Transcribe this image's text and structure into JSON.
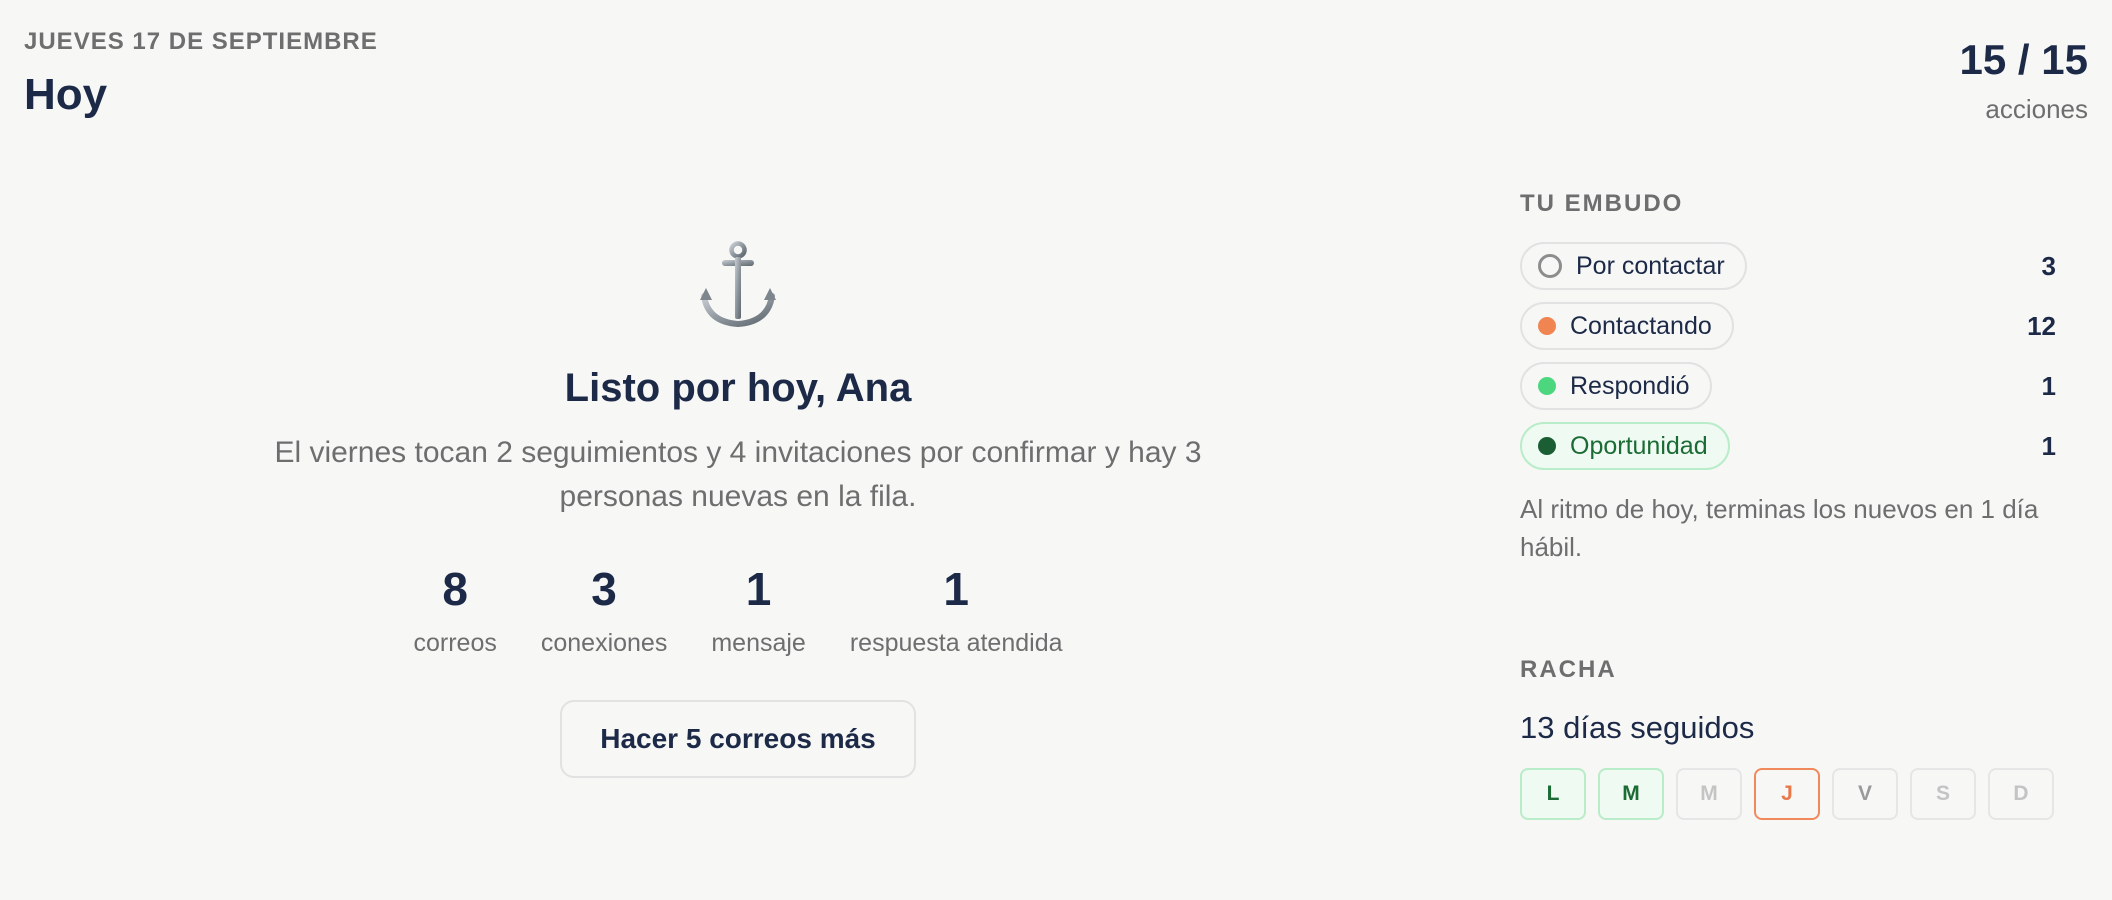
{
  "header": {
    "date": "JUEVES 17 DE SEPTIEMBRE",
    "title": "Hoy",
    "actions_count": "15 / 15",
    "actions_label": "acciones"
  },
  "main": {
    "icon": "anchor-icon",
    "title": "Listo por hoy, Ana",
    "text": "El viernes tocan 2 seguimientos y 4 invitaciones por confirmar y hay 3 personas nuevas en la fila.",
    "stats": [
      {
        "value": "8",
        "label": "correos"
      },
      {
        "value": "3",
        "label": "conexiones"
      },
      {
        "value": "1",
        "label": "mensaje"
      },
      {
        "value": "1",
        "label": "respuesta atendida"
      }
    ],
    "button_label": "Hacer 5 correos más"
  },
  "funnel": {
    "label": "TU EMBUDO",
    "items": [
      {
        "label": "Por contactar",
        "count": "3",
        "color": "#8d8d8d",
        "style": "ring"
      },
      {
        "label": "Contactando",
        "count": "12",
        "color": "#f08552",
        "style": "dot"
      },
      {
        "label": "Respondió",
        "count": "1",
        "color": "#4cd77f",
        "style": "dot"
      },
      {
        "label": "Oportunidad",
        "count": "1",
        "color": "#1b5e34",
        "style": "dot"
      }
    ],
    "pace_text": "Al ritmo de hoy, terminas los nuevos en 1 día hábil."
  },
  "streak": {
    "label": "RACHA",
    "text": "13 días seguidos",
    "days": [
      {
        "label": "L",
        "state": "done"
      },
      {
        "label": "M",
        "state": "done"
      },
      {
        "label": "M",
        "state": "missed"
      },
      {
        "label": "J",
        "state": "today"
      },
      {
        "label": "V",
        "state": "future"
      },
      {
        "label": "S",
        "state": "weekend"
      },
      {
        "label": "D",
        "state": "weekend"
      }
    ]
  }
}
